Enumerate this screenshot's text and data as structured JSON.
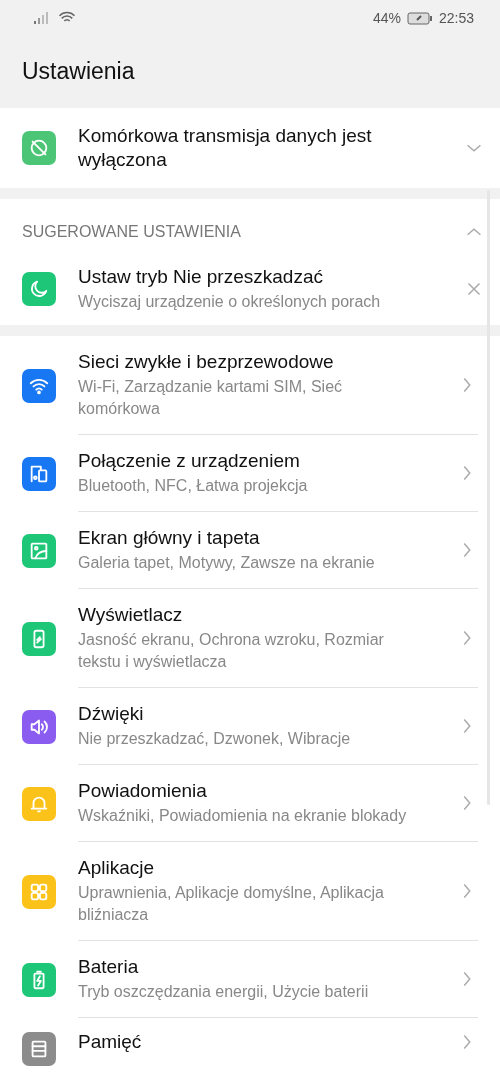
{
  "status_bar": {
    "battery_percent": "44%",
    "time": "22:53"
  },
  "header": {
    "title": "Ustawienia"
  },
  "alert": {
    "title": "Komórkowa transmisja danych jest wyłączona",
    "kind": "data-off",
    "color": "#4cc676",
    "expanded": false
  },
  "suggestions": {
    "heading": "SUGEROWANE USTAWIENIA",
    "expanded": true,
    "items": [
      {
        "title": "Ustaw tryb Nie przeszkadzać",
        "subtitle": "Wyciszaj urządzenie o określonych porach",
        "kind": "moon",
        "color": "#1dc777"
      }
    ]
  },
  "items": [
    {
      "title": "Sieci zwykłe i bezprzewodowe",
      "subtitle": "Wi-Fi, Zarządzanie kartami SIM, Sieć komórkowa",
      "kind": "wifi",
      "color": "#1877f2"
    },
    {
      "title": "Połączenie z urządzeniem",
      "subtitle": "Bluetooth, NFC, Łatwa projekcja",
      "kind": "devices",
      "color": "#1877f2"
    },
    {
      "title": "Ekran główny i tapeta",
      "subtitle": "Galeria tapet, Motywy, Zawsze na ekranie",
      "kind": "image",
      "color": "#1dc777"
    },
    {
      "title": "Wyświetlacz",
      "subtitle": "Jasność ekranu, Ochrona wzroku, Rozmiar tekstu i wyświetlacza",
      "kind": "phone",
      "color": "#1dc777"
    },
    {
      "title": "Dźwięki",
      "subtitle": "Nie przeszkadzać, Dzwonek, Wibracje",
      "kind": "speaker",
      "color": "#8a5cf0"
    },
    {
      "title": "Powiadomienia",
      "subtitle": "Wskaźniki, Powiadomienia na ekranie blokady",
      "kind": "bell",
      "color": "#fbc21a"
    },
    {
      "title": "Aplikacje",
      "subtitle": "Uprawnienia, Aplikacje domyślne, Aplikacja bliźniacza",
      "kind": "apps",
      "color": "#fbc21a"
    },
    {
      "title": "Bateria",
      "subtitle": "Tryb oszczędzania energii, Użycie baterii",
      "kind": "battery",
      "color": "#1dc777"
    },
    {
      "title": "Pamięć",
      "kind": "storage",
      "color": "#8c8c8c"
    }
  ]
}
